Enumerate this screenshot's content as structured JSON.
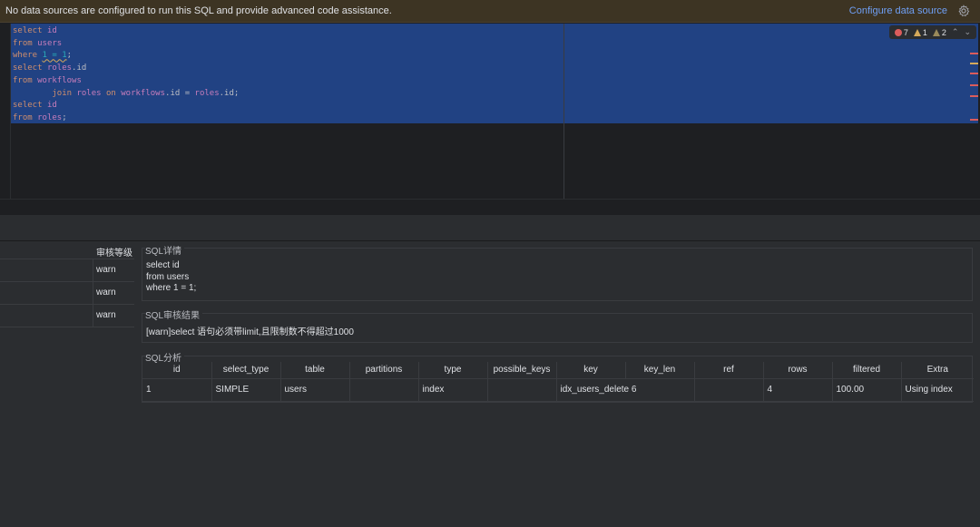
{
  "banner": {
    "message": "No data sources are configured to run this SQL and provide advanced code assistance.",
    "link": "Configure data source",
    "gear_icon": "gear-icon"
  },
  "editor": {
    "inspections": {
      "errors": "7",
      "warnings": "1",
      "weak_warnings": "2"
    },
    "colors": {
      "selection": "#214283",
      "keyword": "#cf8e6d",
      "table": "#c77dbb",
      "number": "#2aacb8"
    },
    "lines": [
      "select id",
      "from users",
      "where 1 = 1;",
      "select roles.id",
      "from workflows",
      "        join roles on workflows.id = roles.id;",
      "select id",
      "from roles;"
    ]
  },
  "audit_list": {
    "header": "审核等级",
    "rows": [
      "warn",
      "warn",
      "warn"
    ]
  },
  "sql_detail": {
    "title": "SQL详情",
    "text": "select id\nfrom users\nwhere 1 = 1;"
  },
  "sql_result": {
    "title": "SQL审核结果",
    "text": "[warn]select 语句必须带limit,且限制数不得超过1000"
  },
  "sql_analysis": {
    "title": "SQL分析",
    "columns": [
      "id",
      "select_type",
      "table",
      "partitions",
      "type",
      "possible_keys",
      "key",
      "key_len",
      "ref",
      "rows",
      "filtered",
      "Extra"
    ],
    "rows": [
      [
        "1",
        "SIMPLE",
        "users",
        "",
        "index",
        "",
        "idx_users_delete",
        "6",
        "",
        "4",
        "100.00",
        "Using index"
      ]
    ]
  }
}
